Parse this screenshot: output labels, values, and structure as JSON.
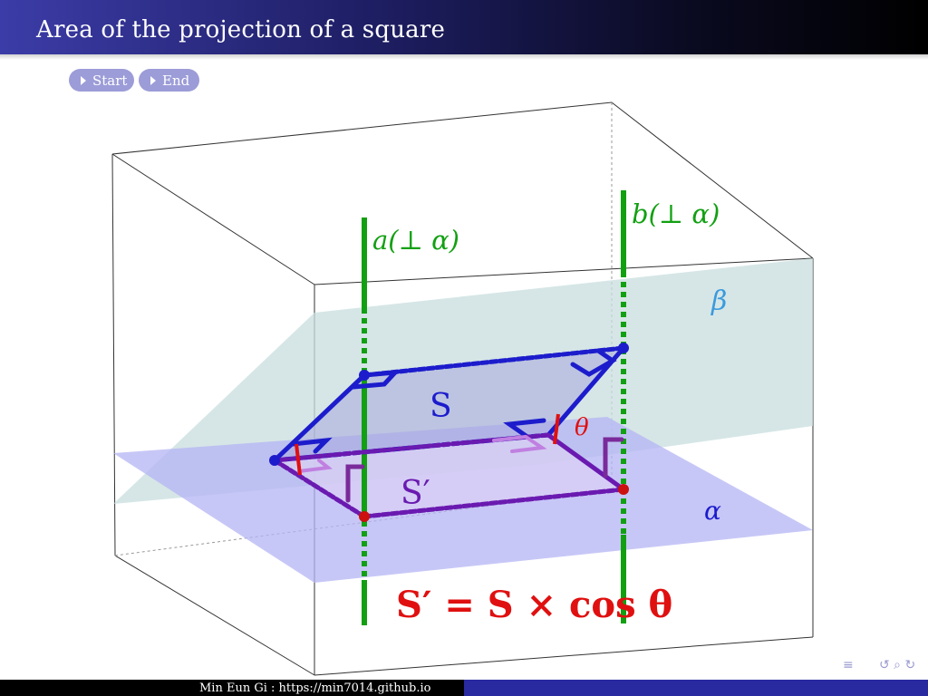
{
  "header": {
    "title": "Area of the projection of a square"
  },
  "controls": {
    "start_label": "Start",
    "end_label": "End"
  },
  "figure": {
    "label_a": "a(⊥ α)",
    "label_b": "b(⊥ α)",
    "label_beta": "β",
    "label_alpha": "α",
    "label_S": "S",
    "label_S_prime": "S′",
    "label_theta": "θ",
    "formula": "S′ = S × cos θ",
    "colors": {
      "line_green": "#12a012",
      "square_blue": "#1c1ccc",
      "projection_purple": "#6a1ab0",
      "angle_red": "#e01010",
      "plane_beta": "#c8dede",
      "plane_alpha": "#b4b4f4"
    }
  },
  "navigation": {
    "icons": [
      "align-icon",
      "loop-icon"
    ]
  },
  "footer": {
    "author": "Min Eun Gi : https://min7014.github.io"
  }
}
